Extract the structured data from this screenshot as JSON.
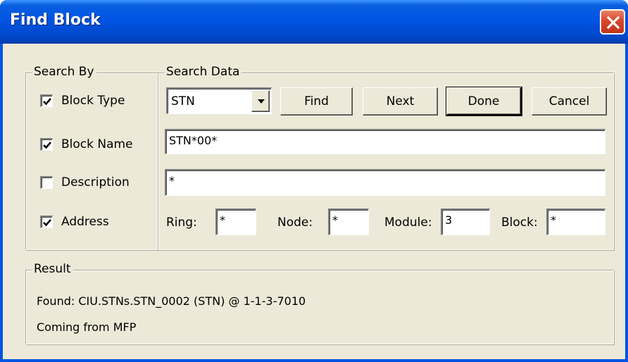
{
  "window": {
    "title": "Find Block"
  },
  "icons": {
    "close": "close-icon",
    "dropdown": "chevron-down-icon",
    "check": "checkmark-icon"
  },
  "colors": {
    "titlebar": "#0054e3",
    "dialog_bg": "#ece9d8",
    "close_button": "#d9472b"
  },
  "search_by": {
    "label": "Search By",
    "options": [
      {
        "label": "Block Type",
        "checked": true
      },
      {
        "label": "Block Name",
        "checked": true
      },
      {
        "label": "Description",
        "checked": false
      },
      {
        "label": "Address",
        "checked": true
      }
    ]
  },
  "search_data": {
    "label": "Search Data",
    "block_type": {
      "value": "STN"
    },
    "buttons": {
      "find": "Find",
      "next": "Next",
      "done": "Done",
      "cancel": "Cancel"
    },
    "block_name": "STN*00*",
    "description": "*",
    "address": {
      "ring_label": "Ring:",
      "ring": "*",
      "node_label": "Node:",
      "node": "*",
      "module_label": "Module:",
      "module": "3",
      "block_label": "Block:",
      "block": "*"
    }
  },
  "result": {
    "label": "Result",
    "found": "Found:  CIU.STNs.STN_0002  (STN) @ 1-1-3-7010",
    "source": "Coming from MFP"
  }
}
